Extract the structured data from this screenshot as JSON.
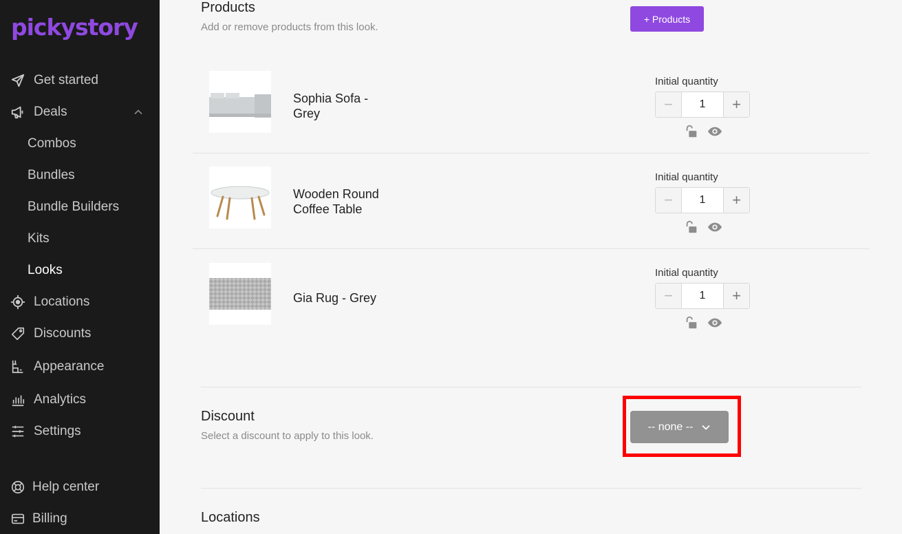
{
  "brand": {
    "logo_text": "pickystory",
    "accent": "#8f49e0"
  },
  "sidebar": {
    "items": [
      {
        "label": "Get started",
        "icon": "send-icon"
      },
      {
        "label": "Deals",
        "icon": "megaphone-icon"
      },
      {
        "label": "Combos",
        "sub": true
      },
      {
        "label": "Bundles",
        "sub": true
      },
      {
        "label": "Bundle Builders",
        "sub": true
      },
      {
        "label": "Kits",
        "sub": true
      },
      {
        "label": "Looks",
        "sub": true,
        "active": true
      },
      {
        "label": "Locations",
        "icon": "target-icon"
      },
      {
        "label": "Discounts",
        "icon": "tag-icon"
      },
      {
        "label": "Appearance",
        "icon": "appearance-icon"
      },
      {
        "label": "Analytics",
        "icon": "bar-chart-icon"
      },
      {
        "label": "Settings",
        "icon": "sliders-icon"
      },
      {
        "label": "Help center",
        "icon": "lifebuoy-icon"
      },
      {
        "label": "Billing",
        "icon": "credit-card-icon"
      }
    ]
  },
  "products_section": {
    "title": "Products",
    "description": "Add or remove products from this look.",
    "add_button": "+ Products",
    "quantity_label": "Initial quantity",
    "items": [
      {
        "name": "Sophia Sofa - Grey",
        "quantity": "1"
      },
      {
        "name": "Wooden Round Coffee Table",
        "quantity": "1"
      },
      {
        "name": "Gia Rug - Grey",
        "quantity": "1"
      }
    ]
  },
  "discount_section": {
    "title": "Discount",
    "description": "Select a discount to apply to this look.",
    "selected": "-- none --"
  },
  "locations_section": {
    "title": "Locations"
  }
}
